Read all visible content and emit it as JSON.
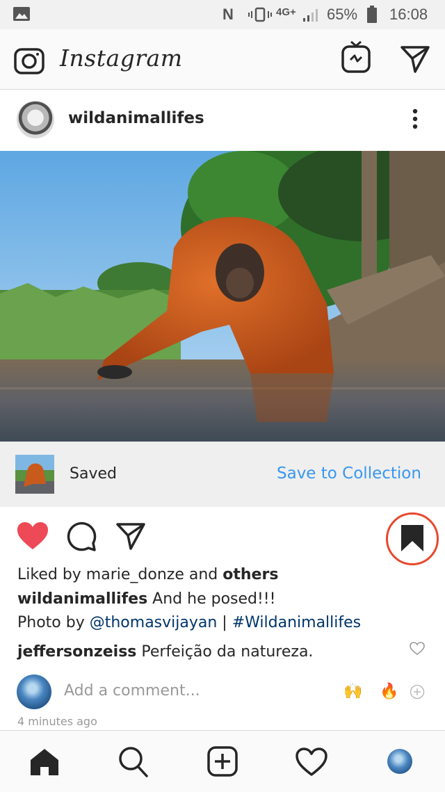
{
  "status_bar": {
    "nfc": "N",
    "network": "4G+",
    "battery_percent": "65%",
    "time": "16:08"
  },
  "header": {
    "app_title": "Instagram"
  },
  "post": {
    "username": "wildanimallifes",
    "saved_label": "Saved",
    "save_to_collection_label": "Save to Collection",
    "liked_by_prefix": "Liked by ",
    "liked_by_user": "marie_donze",
    "liked_by_mid": " and ",
    "liked_by_others": "others",
    "caption_user": "wildanimallifes",
    "caption_text": " And he posed!!!",
    "caption_line2_prefix": "Photo by ",
    "caption_mention": "@thomasvijayan",
    "caption_separator": " | ",
    "caption_hashtag": "#Wildanimallifes",
    "comment_user": "jeffersonzeiss",
    "comment_text": " Perfeição da natureza.",
    "add_comment_placeholder": "Add a comment...",
    "quick_emoji_1": "🙌",
    "quick_emoji_2": "🔥",
    "timestamp": "4 minutes ago",
    "liked": true,
    "saved": true
  },
  "colors": {
    "like_red": "#ed4956",
    "link_blue": "#3897f0",
    "highlight_circle": "#e8482e"
  },
  "icons": [
    "gallery-icon",
    "camera-icon",
    "igtv-icon",
    "direct-icon",
    "more-icon",
    "heart-icon",
    "comment-icon",
    "share-icon",
    "bookmark-icon",
    "home-icon",
    "search-icon",
    "add-icon",
    "activity-icon"
  ]
}
